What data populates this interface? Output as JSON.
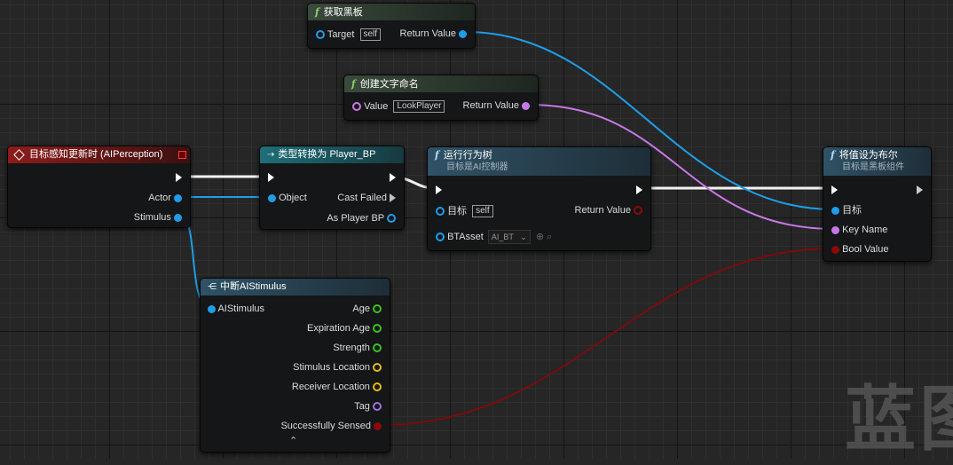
{
  "nodes": {
    "get_blackboard": {
      "title": "获取黑板",
      "target_label": "Target",
      "target_value": "self",
      "return_label": "Return Value"
    },
    "make_name": {
      "title": "创建文字命名",
      "value_label": "Value",
      "value_text": "LookPlayer",
      "return_label": "Return Value"
    },
    "perception": {
      "title": "目标感知更新时 (AIPerception)",
      "actor_label": "Actor",
      "stimulus_label": "Stimulus"
    },
    "cast": {
      "title": "类型转换为 Player_BP",
      "object_label": "Object",
      "cast_failed_label": "Cast Failed",
      "as_player_label": "As Player BP"
    },
    "run_bt": {
      "title": "运行行为树",
      "subtitle": "目标是AI控制器",
      "target_label": "目标",
      "target_value": "self",
      "return_label": "Return Value",
      "btasset_label": "BTAsset",
      "btasset_value": "AI_BT"
    },
    "set_bool": {
      "title": "将值设为布尔",
      "subtitle": "目标是黑板组件",
      "target_label": "目标",
      "keyname_label": "Key Name",
      "bool_label": "Bool Value"
    },
    "break_stimulus": {
      "title": "中断AIStimulus",
      "input_label": "AIStimulus",
      "outputs": [
        "Age",
        "Expiration Age",
        "Strength",
        "Stimulus Location",
        "Receiver Location",
        "Tag",
        "Successfully Sensed"
      ]
    }
  },
  "watermark": "蓝图",
  "colors": {
    "object_pin": "#1e9de8",
    "name_pin": "#c878e6",
    "bool_pin": "#8c0a0a",
    "float_pin": "#38c31c",
    "vector_pin": "#e6b914",
    "event_header": "#8a1616",
    "cast_header": "#1c5f69",
    "func_header_green": "#2e3c32",
    "func_header_blue": "#2c4e60"
  }
}
